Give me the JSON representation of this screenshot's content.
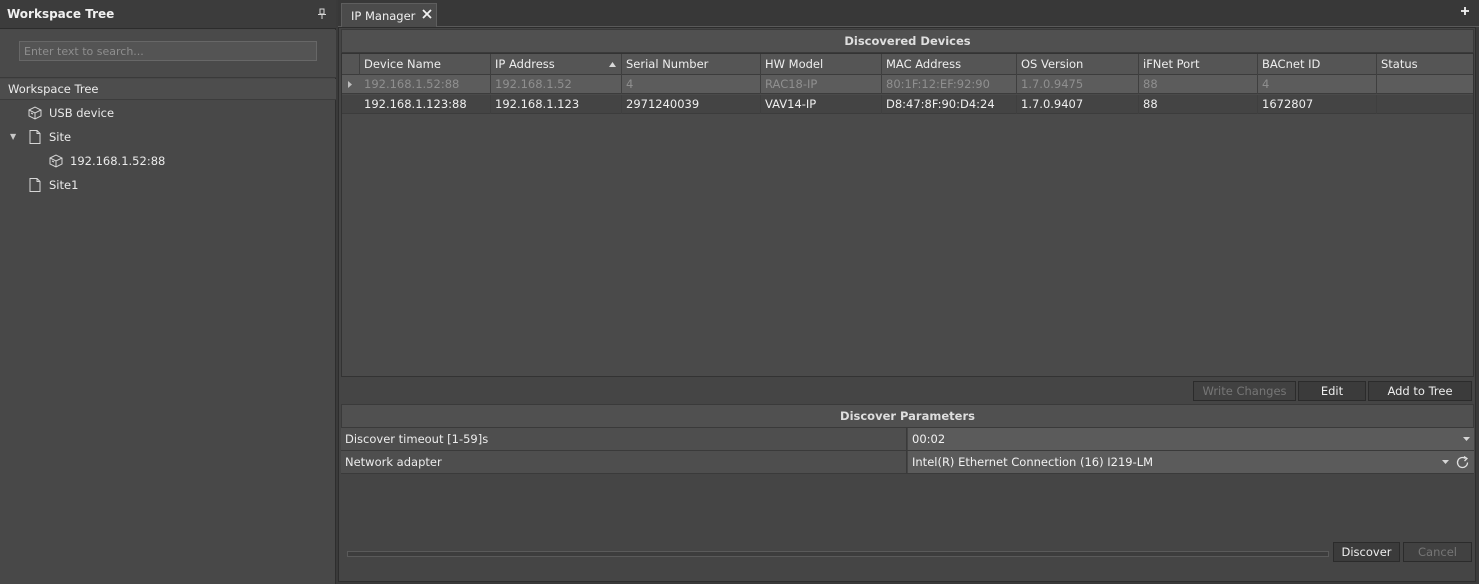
{
  "workspace": {
    "title": "Workspace Tree",
    "search_placeholder": "Enter text to search...",
    "tree_header": "Workspace Tree",
    "items": [
      {
        "label": "USB device",
        "icon": "device-icon"
      },
      {
        "label": "Site",
        "icon": "document-icon",
        "expanded": true
      },
      {
        "label": "192.168.1.52:88",
        "icon": "device-icon"
      },
      {
        "label": "Site1",
        "icon": "document-icon"
      }
    ]
  },
  "tabs": [
    {
      "label": "IP Manager",
      "active": true
    }
  ],
  "discovered": {
    "title": "Discovered Devices",
    "columns": [
      "Device Name",
      "IP Address",
      "Serial Number",
      "HW Model",
      "MAC Address",
      "OS Version",
      "iFNet Port",
      "BACnet ID",
      "Status"
    ],
    "sort_column": "IP Address",
    "rows": [
      [
        "192.168.1.52:88",
        "192.168.1.52",
        "4",
        "RAC18-IP",
        "80:1F:12:EF:92:90",
        "1.7.0.9475",
        "88",
        "4",
        ""
      ],
      [
        "192.168.1.123:88",
        "192.168.1.123",
        "2971240039",
        "VAV14-IP",
        "D8:47:8F:90:D4:24",
        "1.7.0.9407",
        "88",
        "1672807",
        ""
      ]
    ]
  },
  "actions": {
    "write_changes": "Write Changes",
    "edit": "Edit",
    "add_to_tree": "Add to Tree"
  },
  "parameters": {
    "title": "Discover Parameters",
    "timeout_label": "Discover timeout [1-59]s",
    "timeout_value": "00:02",
    "adapter_label": "Network adapter",
    "adapter_value": "Intel(R) Ethernet Connection (16) I219-LM"
  },
  "footer": {
    "discover": "Discover",
    "cancel": "Cancel"
  },
  "colors": {
    "panel": "#484848",
    "dim_row": "#5c5c5c",
    "dim_text": "#8f8f8f"
  }
}
